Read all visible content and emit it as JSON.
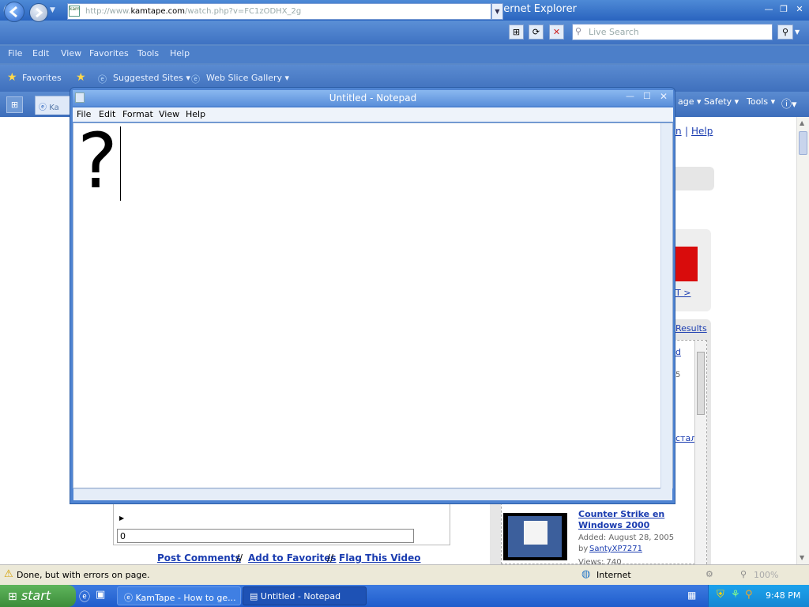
{
  "browser": {
    "title": "KamTape - How to get msn messenger - Windows Internet Explorer",
    "address": {
      "prefix": "http://www.",
      "host": "kamtape.com",
      "path": "/watch.php?v=FC1zODHX_2g",
      "favicon_text": "kam"
    },
    "search_placeholder": "Live Search",
    "menu": [
      "File",
      "Edit",
      "View",
      "Favorites",
      "Tools",
      "Help"
    ],
    "favorites_label": "Favorites",
    "favbar_items": [
      "Suggested Sites",
      "Web Slice Gallery"
    ],
    "tab_partial": "Ka",
    "command_items": [
      "age",
      "Safety",
      "Tools"
    ],
    "status_text": "Done, but with errors on page.",
    "zone": "Internet",
    "zoom": "100%"
  },
  "page": {
    "header_partial": "n",
    "help_link": "Help",
    "sidebar": {
      "banner_link": "T >",
      "results_link": "Results",
      "item_partial": "d",
      "item_num": "5",
      "cyrillic_partial": "стал"
    },
    "video": {
      "title": "Counter Strike en Windows 2000",
      "added": "Added: August 28, 2005",
      "by_label": "by",
      "author": "SantyXP7271",
      "views": "Views: 740"
    },
    "comment_count": "0",
    "actions": [
      "Post Comments",
      "Add to Favorites",
      "Flag This Video"
    ],
    "separator": "//"
  },
  "notepad": {
    "title": "Untitled - Notepad",
    "menu": [
      "File",
      "Edit",
      "Format",
      "View",
      "Help"
    ],
    "content": "?"
  },
  "taskbar": {
    "start": "start",
    "tasks": [
      "KamTape - How to ge...",
      "Untitled - Notepad"
    ],
    "clock": "9:48 PM"
  },
  "colors": {
    "titlebar": "#2a64bf",
    "notepad_frame": "#4f84d2",
    "link": "#1a3cb0",
    "taskbar": "#1f5ccc",
    "start": "#3c8d3a"
  }
}
